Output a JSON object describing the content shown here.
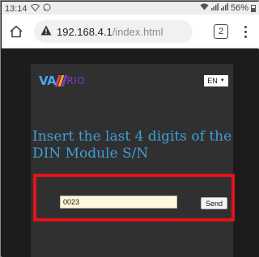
{
  "status_bar": {
    "time": "13:14",
    "left_icons": [
      "wifi-icon",
      "whatsapp-icon"
    ],
    "right_icons": [
      "wifi-icon",
      "signal-icon",
      "signal-icon"
    ],
    "battery": "56%"
  },
  "address_bar": {
    "home_icon": "home-icon",
    "security_icon": "warning-icon",
    "url_host": "192.168.4.1",
    "url_path": "/index.html",
    "tab_count": "2",
    "menu_icon": "more-vertical-icon"
  },
  "page": {
    "logo": {
      "va": "VA",
      "rio": "RIO",
      "bar_colors": [
        "#e4338b",
        "#f5b400",
        "#7d3ac2"
      ]
    },
    "language": {
      "selected": "EN",
      "caret": "▼"
    },
    "title": "Insert the last 4 digits of the DIN Module S/N",
    "serial_input_value": "0023",
    "send_label": "Send",
    "colors": {
      "accent": "#3f9fd8",
      "highlight": "#e3121a",
      "panel": "#303030",
      "background": "#1c1c1c"
    }
  }
}
